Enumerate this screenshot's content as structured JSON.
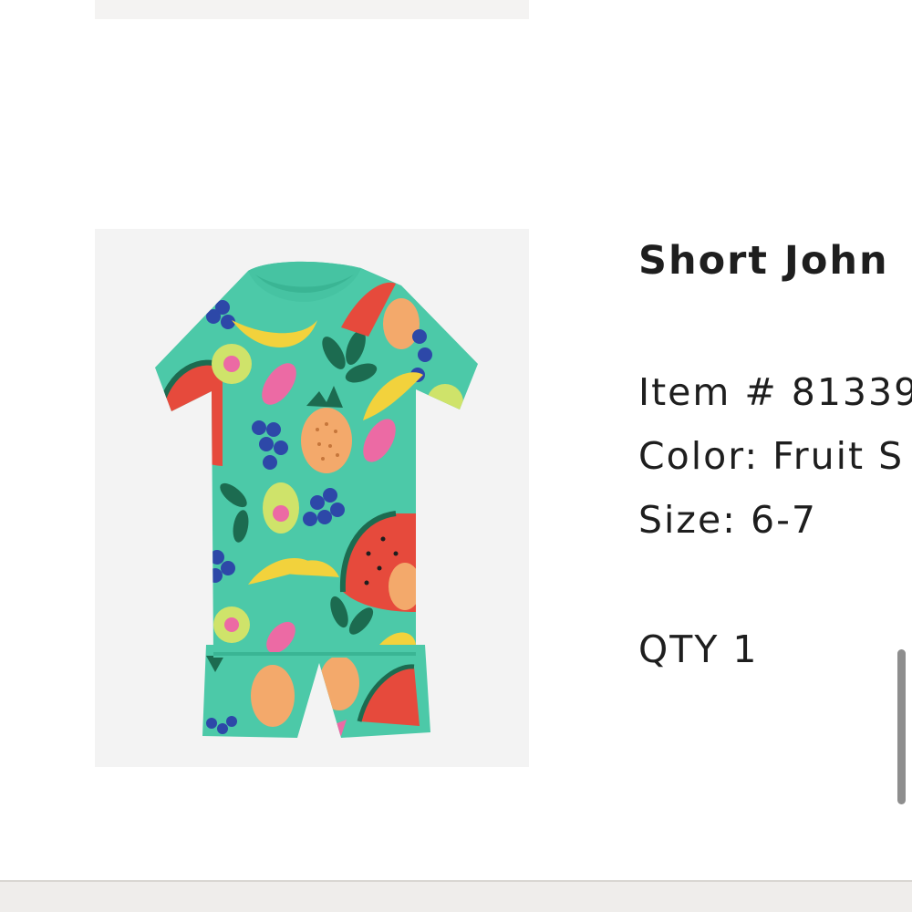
{
  "cart_item": {
    "title": "Short John",
    "item_number": "Item # 81339",
    "color": "Color: Fruit S",
    "size": "Size: 6-7",
    "quantity": "QTY 1",
    "image_alt": "Fruit print short john pajamas"
  },
  "colors": {
    "shirt": "#4cc9a8",
    "watermelon": "#e64a3c",
    "banana": "#f2d23c",
    "blueberry": "#2d48a8",
    "leaf": "#1c6b50",
    "pineapple": "#f3a96b",
    "pink": "#ec6aa4",
    "lime": "#cfe36a"
  },
  "icons": {
    "scrollbar": "scrollbar-thumb"
  }
}
